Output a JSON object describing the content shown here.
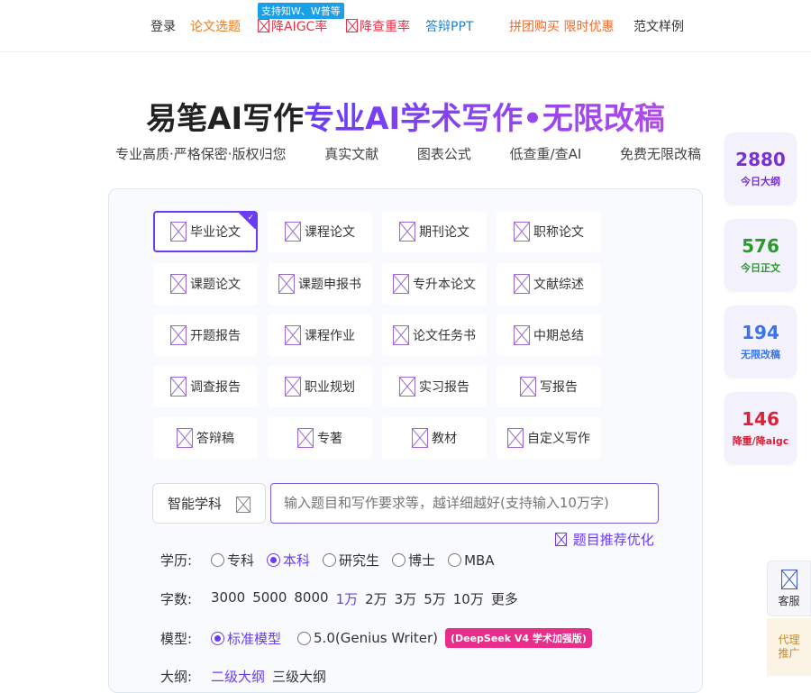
{
  "nav": {
    "badge": "支持知W、W普等",
    "login": "登录",
    "topic": "论文选题",
    "aigc": "降AIGC率",
    "dup": "降查重率",
    "ppt": "答辩PPT",
    "group": "拼团购买 限时优惠",
    "sample": "范文样例"
  },
  "hero": {
    "title_dark": "易笔AI写作",
    "title_grad": "专业AI学术写作•无限改稿",
    "features": [
      "专业高质·严格保密·版权归您",
      "真实文献",
      "图表公式",
      "低查重/查AI",
      "免费无限改稿"
    ]
  },
  "types": [
    {
      "label": "毕业论文",
      "active": true
    },
    {
      "label": "课程论文"
    },
    {
      "label": "期刊论文"
    },
    {
      "label": "职称论文"
    },
    {
      "label": "课题论文"
    },
    {
      "label": "课题申报书"
    },
    {
      "label": "专升本论文"
    },
    {
      "label": "文献综述"
    },
    {
      "label": "开题报告"
    },
    {
      "label": "课程作业"
    },
    {
      "label": "论文任务书"
    },
    {
      "label": "中期总结"
    },
    {
      "label": "调查报告"
    },
    {
      "label": "职业规划"
    },
    {
      "label": "实习报告"
    },
    {
      "label": "写报告"
    },
    {
      "label": "答辩稿"
    },
    {
      "label": "专著"
    },
    {
      "label": "教材"
    },
    {
      "label": "自定义写作"
    }
  ],
  "form": {
    "subject": "智能学科",
    "topic_placeholder": "输入题目和写作要求等，越详细越好(支持输入10万字)",
    "optimize": "题目推荐优化",
    "edu_label": "学历:",
    "edu_options": [
      "专科",
      "本科",
      "研究生",
      "博士",
      "MBA"
    ],
    "edu_selected": "本科",
    "words_label": "字数:",
    "words_options": [
      "3000",
      "5000",
      "8000",
      "1万",
      "2万",
      "3万",
      "5万",
      "10万",
      "更多"
    ],
    "words_selected": "1万",
    "model_label": "模型:",
    "model_options": [
      "标准模型",
      "5.0(Genius Writer)"
    ],
    "model_selected": "标准模型",
    "model_badge": "(DeepSeek V4 学术加强版)",
    "outline_label": "大纲:",
    "outline_options": [
      "二级大纲",
      "三级大纲"
    ]
  },
  "stats": [
    {
      "num": "2880",
      "label": "今日大纲",
      "color": "#7b2fd6"
    },
    {
      "num": "576",
      "label": "今日正文",
      "color": "#2a9a2a"
    },
    {
      "num": "194",
      "label": "无限改稿",
      "color": "#3b73e8"
    },
    {
      "num": "146",
      "label": "降重/降aigc",
      "color": "#d8223a"
    }
  ],
  "service": {
    "label": "客服",
    "agent": "代理推广"
  }
}
